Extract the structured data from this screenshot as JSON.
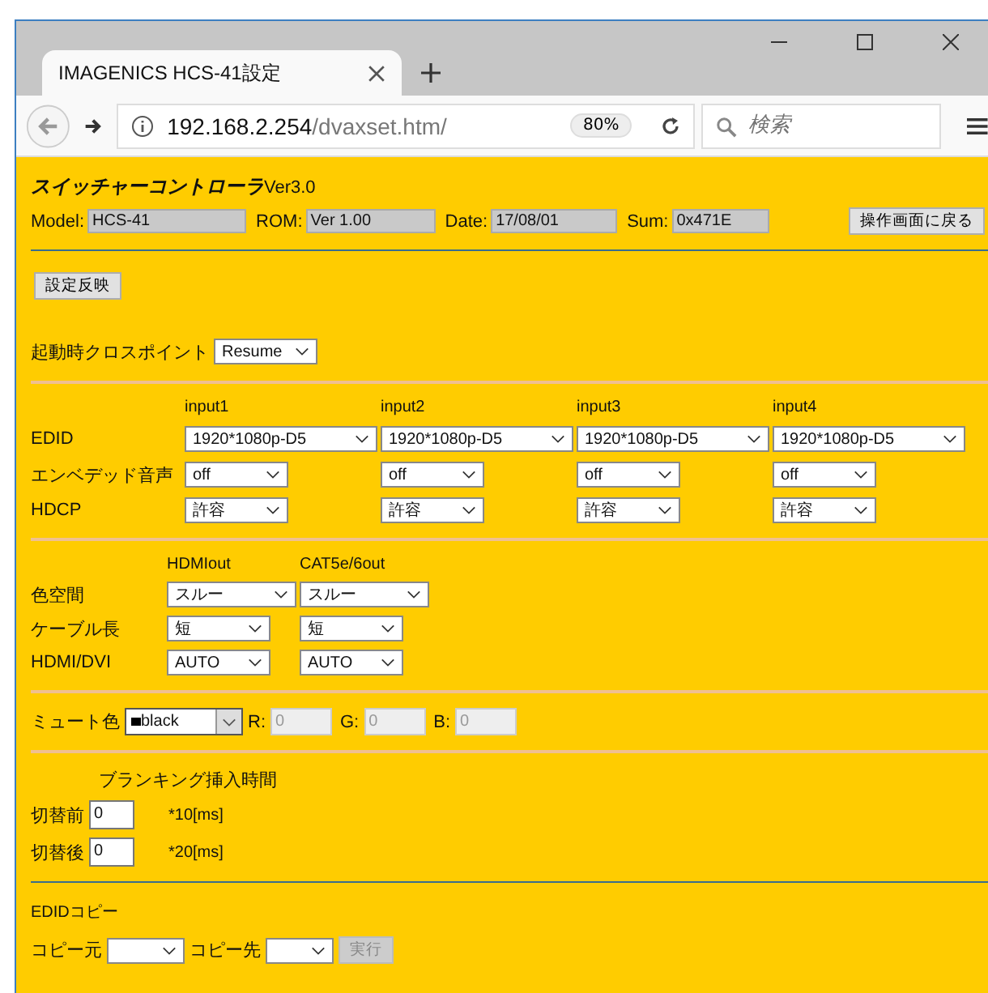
{
  "browser": {
    "tab_title": "IMAGENICS HCS-41設定",
    "url_host": "192.168.2.254",
    "url_path": "/dvaxset.htm/",
    "zoom": "80%",
    "search_placeholder": "検索"
  },
  "header": {
    "title": "スイッチャーコントローラ",
    "version": "Ver3.0",
    "info": [
      {
        "label": "Model:",
        "value": "HCS-41"
      },
      {
        "label": "ROM:",
        "value": "Ver 1.00"
      },
      {
        "label": "Date:",
        "value": "17/08/01"
      },
      {
        "label": "Sum:",
        "value": "0x471E"
      }
    ],
    "back_button": "操作画面に戻る"
  },
  "apply_button": "設定反映",
  "startup": {
    "label": "起動時クロスポイント",
    "value": "Resume"
  },
  "inputs": {
    "columns": [
      "input1",
      "input2",
      "input3",
      "input4"
    ],
    "rows": [
      {
        "label": "EDID",
        "kind": "wide",
        "values": [
          "1920*1080p-D5",
          "1920*1080p-D5",
          "1920*1080p-D5",
          "1920*1080p-D5"
        ]
      },
      {
        "label": "エンベデッド音声",
        "kind": "short",
        "values": [
          "off",
          "off",
          "off",
          "off"
        ]
      },
      {
        "label": "HDCP",
        "kind": "short",
        "values": [
          "許容",
          "許容",
          "許容",
          "許容"
        ]
      }
    ]
  },
  "outputs": {
    "columns": [
      "HDMIout",
      "CAT5e/6out"
    ],
    "rows": [
      {
        "label": "色空間",
        "kind": "wide",
        "values": [
          "スルー",
          "スルー"
        ]
      },
      {
        "label": "ケーブル長",
        "kind": "short",
        "values": [
          "短",
          "短"
        ]
      },
      {
        "label": "HDMI/DVI",
        "kind": "short",
        "values": [
          "AUTO",
          "AUTO"
        ]
      }
    ]
  },
  "mute": {
    "label": "ミュート色",
    "value": "black",
    "channels": [
      {
        "label": "R:",
        "value": "0",
        "disabled": true
      },
      {
        "label": "G:",
        "value": "0",
        "disabled": true
      },
      {
        "label": "B:",
        "value": "0",
        "disabled": true
      }
    ]
  },
  "blanking": {
    "title": "ブランキング挿入時間",
    "rows": [
      {
        "label": "切替前",
        "value": "0",
        "unit": "*10[ms]"
      },
      {
        "label": "切替後",
        "value": "0",
        "unit": "*20[ms]"
      }
    ]
  },
  "edid_copy": {
    "title": "EDIDコピー",
    "source_label": "コピー元",
    "dest_label": "コピー先",
    "run_button": {
      "label": "実行",
      "disabled": true
    }
  }
}
